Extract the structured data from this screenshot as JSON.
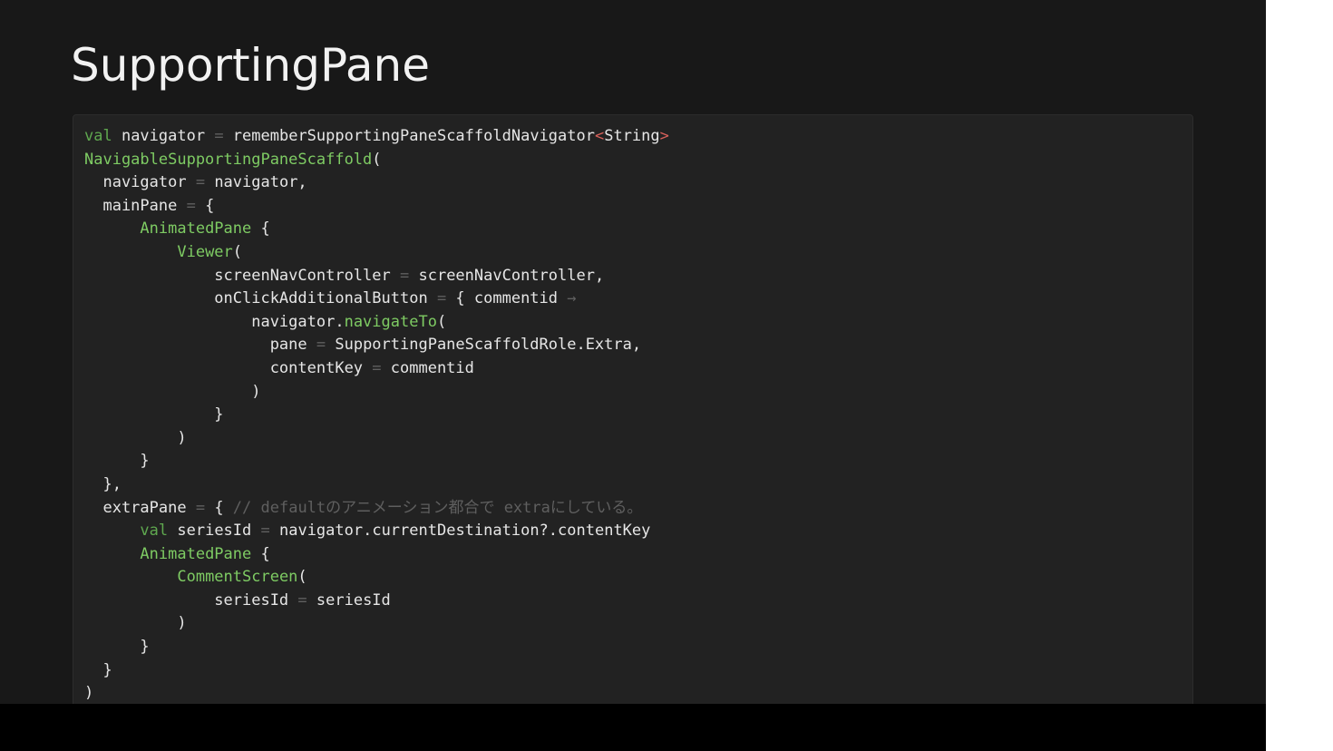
{
  "slide": {
    "title": "SupportingPane",
    "code_lines": [
      [
        [
          "kw",
          "val"
        ],
        [
          "id",
          " navigator "
        ],
        [
          "op",
          "="
        ],
        [
          "id",
          " rememberSupportingPaneScaffoldNavigator"
        ],
        [
          "gen",
          "<"
        ],
        [
          "id",
          "String"
        ],
        [
          "gen",
          ">"
        ]
      ],
      [
        [
          "fn",
          "NavigableSupportingPaneScaffold"
        ],
        [
          "pu",
          "("
        ]
      ],
      [
        [
          "id",
          "  navigator "
        ],
        [
          "op",
          "="
        ],
        [
          "id",
          " navigator,"
        ]
      ],
      [
        [
          "id",
          "  mainPane "
        ],
        [
          "op",
          "="
        ],
        [
          "id",
          " {"
        ]
      ],
      [
        [
          "id",
          "      "
        ],
        [
          "fn",
          "AnimatedPane"
        ],
        [
          "id",
          " {"
        ]
      ],
      [
        [
          "id",
          "          "
        ],
        [
          "fn",
          "Viewer"
        ],
        [
          "pu",
          "("
        ]
      ],
      [
        [
          "id",
          "              screenNavController "
        ],
        [
          "op",
          "="
        ],
        [
          "id",
          " screenNavController,"
        ]
      ],
      [
        [
          "id",
          "              onClickAdditionalButton "
        ],
        [
          "op",
          "="
        ],
        [
          "id",
          " { commentid "
        ],
        [
          "op",
          "→"
        ]
      ],
      [
        [
          "id",
          "                  navigator."
        ],
        [
          "fn",
          "navigateTo"
        ],
        [
          "pu",
          "("
        ]
      ],
      [
        [
          "id",
          "                    pane "
        ],
        [
          "op",
          "="
        ],
        [
          "id",
          " SupportingPaneScaffoldRole.Extra,"
        ]
      ],
      [
        [
          "id",
          "                    contentKey "
        ],
        [
          "op",
          "="
        ],
        [
          "id",
          " commentid"
        ]
      ],
      [
        [
          "id",
          "                  )"
        ]
      ],
      [
        [
          "id",
          "              }"
        ]
      ],
      [
        [
          "id",
          "          )"
        ]
      ],
      [
        [
          "id",
          "      }"
        ]
      ],
      [
        [
          "id",
          "  },"
        ]
      ],
      [
        [
          "id",
          "  extraPane "
        ],
        [
          "op",
          "="
        ],
        [
          "id",
          " { "
        ],
        [
          "cm",
          "// defaultのアニメーション都合で extraにしている。"
        ]
      ],
      [
        [
          "id",
          "      "
        ],
        [
          "kw",
          "val"
        ],
        [
          "id",
          " seriesId "
        ],
        [
          "op",
          "="
        ],
        [
          "id",
          " navigator.currentDestination?.contentKey"
        ]
      ],
      [
        [
          "id",
          "      "
        ],
        [
          "fn",
          "AnimatedPane"
        ],
        [
          "id",
          " {"
        ]
      ],
      [
        [
          "id",
          "          "
        ],
        [
          "fn",
          "CommentScreen"
        ],
        [
          "pu",
          "("
        ]
      ],
      [
        [
          "id",
          "              seriesId "
        ],
        [
          "op",
          "="
        ],
        [
          "id",
          " seriesId"
        ]
      ],
      [
        [
          "id",
          "          )"
        ]
      ],
      [
        [
          "id",
          "      }"
        ]
      ],
      [
        [
          "id",
          "  }"
        ]
      ],
      [
        [
          "id",
          ")"
        ]
      ]
    ]
  },
  "colors": {
    "slide_background": "#181818",
    "code_background": "#222222",
    "keyword": "#5fa84f",
    "function": "#7ecb63",
    "identifier": "#e6e6e6",
    "operator": "#606060",
    "generic_bracket": "#d9615b",
    "comment": "#5f5f5f"
  }
}
